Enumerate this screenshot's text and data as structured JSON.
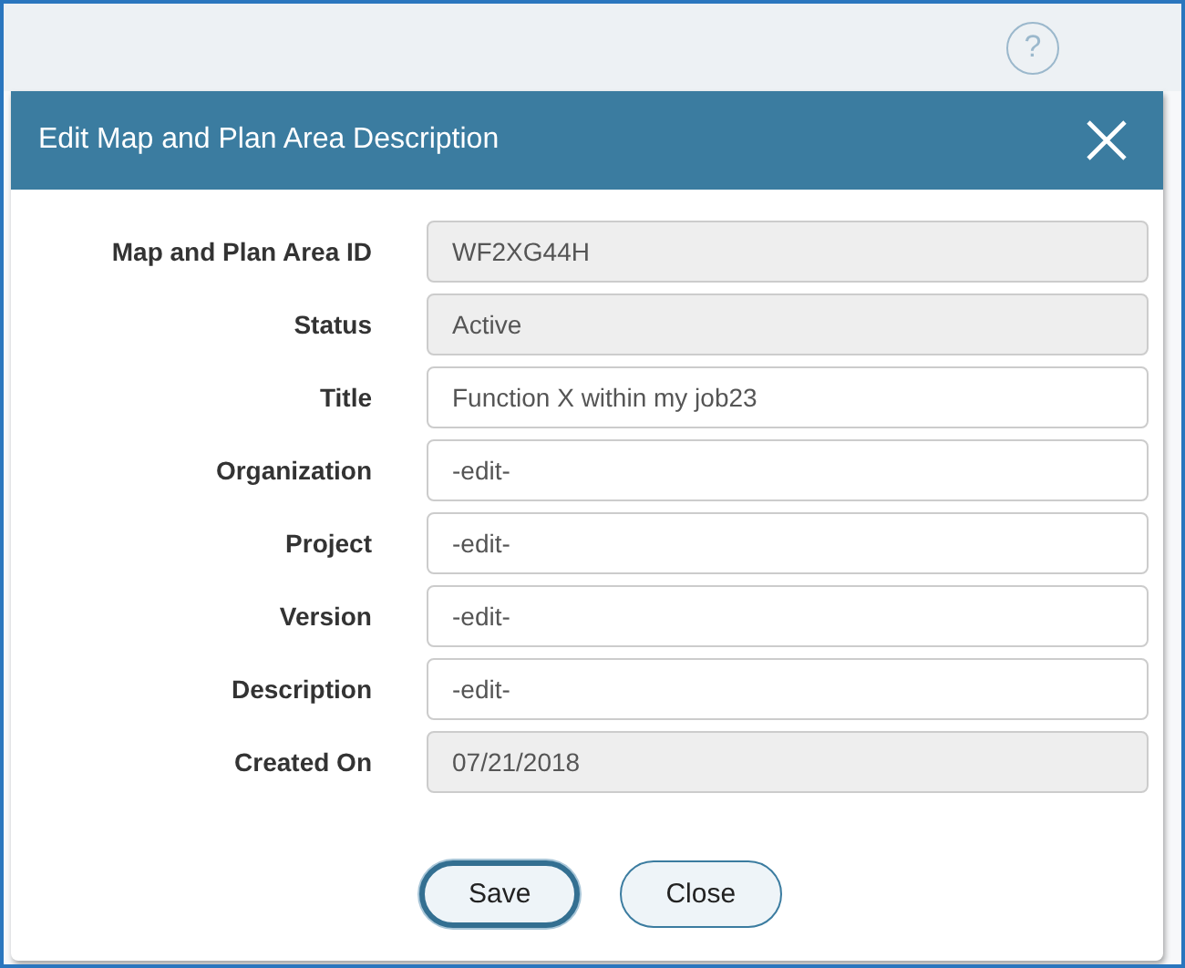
{
  "dialog": {
    "title": "Edit Map and Plan Area Description",
    "help_glyph": "?"
  },
  "fields": [
    {
      "label": "Map and Plan Area ID",
      "value": "WF2XG44H",
      "disabled": true
    },
    {
      "label": "Status",
      "value": "Active",
      "disabled": true
    },
    {
      "label": "Title",
      "value": "Function X within my job23",
      "disabled": false
    },
    {
      "label": "Organization",
      "value": "-edit-",
      "disabled": false
    },
    {
      "label": "Project",
      "value": "-edit-",
      "disabled": false
    },
    {
      "label": "Version",
      "value": "-edit-",
      "disabled": false
    },
    {
      "label": "Description",
      "value": "-edit-",
      "disabled": false
    },
    {
      "label": "Created On",
      "value": "07/21/2018",
      "disabled": true
    }
  ],
  "buttons": [
    {
      "label": "Save",
      "focused": true
    },
    {
      "label": "Close",
      "focused": false
    }
  ]
}
